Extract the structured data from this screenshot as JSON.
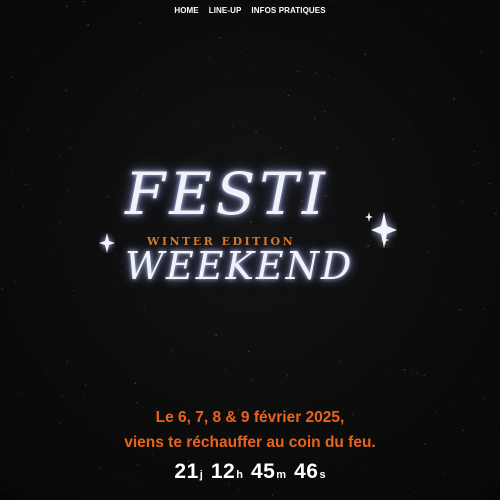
{
  "nav": {
    "items": [
      {
        "label": "HOME"
      },
      {
        "label": "LINE-UP"
      },
      {
        "label": "INFOS PRATIQUES"
      }
    ]
  },
  "logo": {
    "line1": "FESTI",
    "subtitle": "WINTER EDITION",
    "line2": "WEEKEND"
  },
  "tagline": {
    "line1": "Le 6, 7, 8 & 9 février 2025,",
    "line2": "viens te réchauffer au coin du feu."
  },
  "countdown": {
    "days": "21",
    "days_suffix": "j",
    "hours": "12",
    "hours_suffix": "h",
    "minutes": "45",
    "minutes_suffix": "m",
    "seconds": "46",
    "seconds_suffix": "s"
  },
  "colors": {
    "background": "#0b0b0b",
    "accent_orange": "#e8641d",
    "logo_white": "#f1f2f8",
    "subtitle_orange": "#d27a2c"
  }
}
